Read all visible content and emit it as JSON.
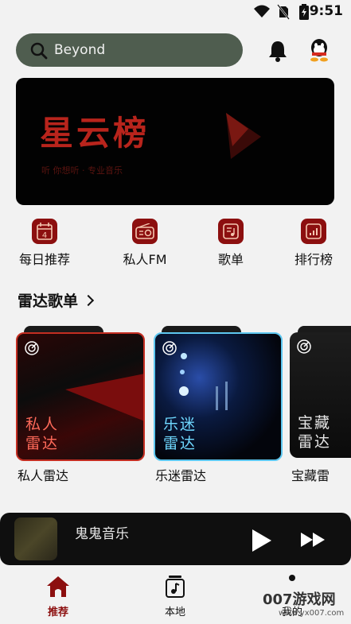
{
  "status": {
    "time": "9:51",
    "icons": [
      "wifi-icon",
      "no-sim-icon",
      "battery-icon"
    ]
  },
  "search": {
    "value": "Beyond"
  },
  "banner": {
    "logo": "星云榜",
    "sub": "听 你想听 · 专业音乐"
  },
  "quick": [
    {
      "label": "每日推荐",
      "icon": "calendar-icon",
      "badge": "4"
    },
    {
      "label": "私人FM",
      "icon": "radio-icon"
    },
    {
      "label": "歌单",
      "icon": "playlist-icon"
    },
    {
      "label": "排行榜",
      "icon": "chart-icon"
    }
  ],
  "section": {
    "title": "雷达歌单"
  },
  "cards": [
    {
      "cover": [
        "私人",
        "雷达"
      ],
      "caption": "私人雷达",
      "color": "#ff6a5a"
    },
    {
      "cover": [
        "乐迷",
        "雷达"
      ],
      "caption": "乐迷雷达",
      "color": "#6fd8ff"
    },
    {
      "cover": [
        "宝藏",
        "雷达"
      ],
      "caption": "宝藏雷",
      "color": "#e6e6e6"
    }
  ],
  "player": {
    "song": "鬼鬼音乐"
  },
  "tabs": [
    {
      "label": "推荐",
      "active": true
    },
    {
      "label": "本地",
      "active": false
    },
    {
      "label": "我的",
      "active": false
    }
  ],
  "watermark": {
    "text": "007游戏网",
    "url": "www.yx007.com"
  },
  "colors": {
    "accent": "#8c0f0f",
    "search_bg": "#4f5d4f"
  }
}
